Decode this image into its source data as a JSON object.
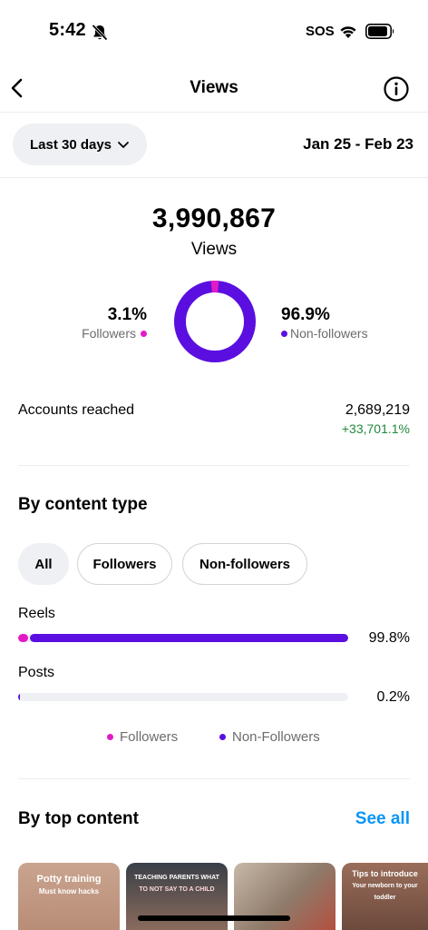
{
  "status_bar": {
    "time": "5:42",
    "carrier": "SOS"
  },
  "header": {
    "title": "Views"
  },
  "filter": {
    "range_label": "Last 30 days",
    "date_range": "Jan 25 - Feb 23"
  },
  "summary": {
    "total": "3,990,867",
    "total_label": "Views",
    "followers_pct": "3.1%",
    "followers_label": "Followers",
    "non_followers_pct": "96.9%",
    "non_followers_label": "Non-followers",
    "followers_fraction": 0.031
  },
  "reach": {
    "label": "Accounts reached",
    "value": "2,689,219",
    "change": "+33,701.1%"
  },
  "content_type": {
    "title": "By content type",
    "chips": [
      "All",
      "Followers",
      "Non-followers"
    ],
    "active_chip": "All",
    "rows": [
      {
        "label": "Reels",
        "pct": "99.8%",
        "share": 0.998,
        "followers_share": 0.031
      },
      {
        "label": "Posts",
        "pct": "0.2%",
        "share": 0.002,
        "followers_share": 0.0
      }
    ],
    "legend": {
      "followers": "Followers",
      "non_followers": "Non-Followers"
    }
  },
  "top_content": {
    "title": "By top content",
    "see_all": "See all",
    "thumbnails": [
      {
        "text_1": "Potty training",
        "text_2": "Must know hacks"
      },
      {
        "text_1": "TEACHING PARENTS WHAT",
        "text_2": "TO NOT SAY TO A CHILD"
      },
      {
        "text_1": "",
        "text_2": ""
      },
      {
        "text_1": "Tips to introduce",
        "text_2": "Your newborn to your toddler"
      }
    ]
  },
  "colors": {
    "followers": "#e21ac6",
    "non_followers": "#5a0fe0",
    "positive": "#1f8a3b",
    "link": "#0a95f6",
    "chip_bg": "#eef0f3"
  },
  "icons": [
    "bell-slash-icon",
    "wifi-icon",
    "battery-icon",
    "back-arrow-icon",
    "info-icon",
    "chevron-down-icon"
  ]
}
